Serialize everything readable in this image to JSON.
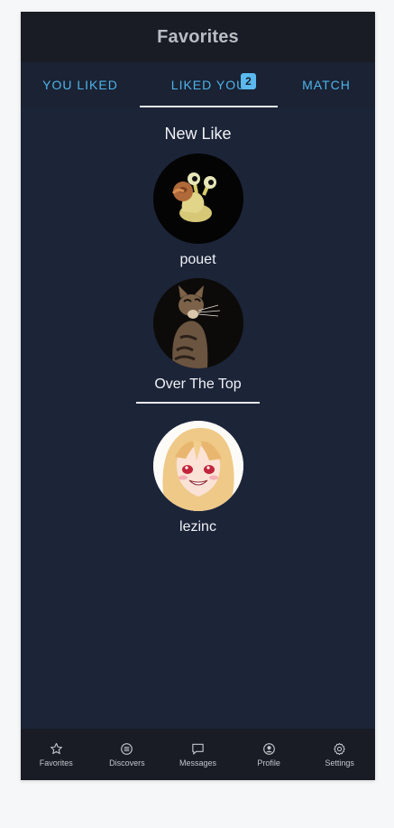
{
  "header": {
    "title": "Favorites"
  },
  "tabs": [
    {
      "label": "YOU LIKED"
    },
    {
      "label": "LIKED YOU",
      "badge": "2"
    },
    {
      "label": "MATCH"
    }
  ],
  "new_like": {
    "title": "New Like",
    "profiles": [
      {
        "name": "pouet"
      },
      {
        "name": "Over The Top"
      }
    ]
  },
  "other_likes": [
    {
      "name": "lezinc"
    }
  ],
  "bottom_nav": [
    {
      "label": "Favorites",
      "icon": "star-icon"
    },
    {
      "label": "Discovers",
      "icon": "list-icon"
    },
    {
      "label": "Messages",
      "icon": "chat-icon"
    },
    {
      "label": "Profile",
      "icon": "user-circle-icon"
    },
    {
      "label": "Settings",
      "icon": "gear-icon"
    }
  ],
  "colors": {
    "background": "#1c2438",
    "app_bar": "#191c24",
    "accent": "#4fb3ea",
    "text": "#f0f2f5"
  }
}
